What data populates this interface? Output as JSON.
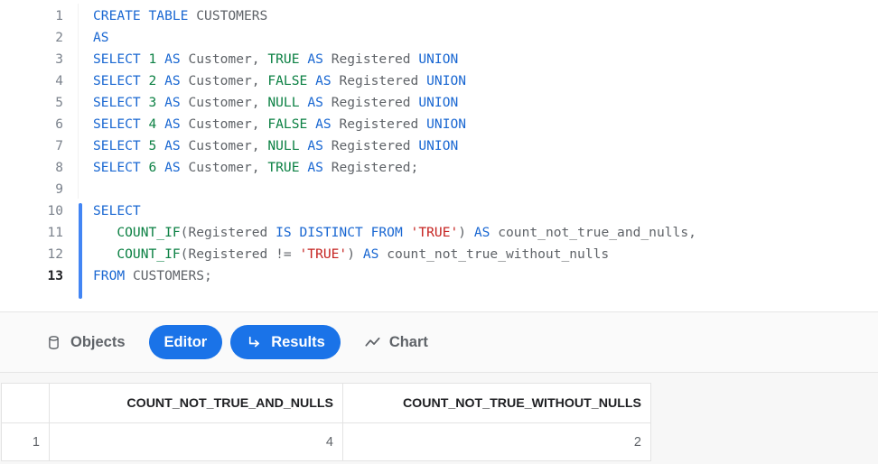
{
  "editor": {
    "line_numbers": [
      "1",
      "2",
      "3",
      "4",
      "5",
      "6",
      "7",
      "8",
      "9",
      "10",
      "11",
      "12",
      "13"
    ],
    "active_line": "13",
    "lines": [
      {
        "n": "1",
        "tokens": [
          {
            "t": "CREATE",
            "c": "kw"
          },
          {
            "t": " ",
            "c": "pn"
          },
          {
            "t": "TABLE",
            "c": "kw"
          },
          {
            "t": " ",
            "c": "pn"
          },
          {
            "t": "CUSTOMERS",
            "c": "id"
          }
        ]
      },
      {
        "n": "2",
        "tokens": [
          {
            "t": "AS",
            "c": "kw"
          }
        ]
      },
      {
        "n": "3",
        "tokens": [
          {
            "t": "SELECT",
            "c": "kw"
          },
          {
            "t": " ",
            "c": "pn"
          },
          {
            "t": "1",
            "c": "lit"
          },
          {
            "t": " ",
            "c": "pn"
          },
          {
            "t": "AS",
            "c": "kw"
          },
          {
            "t": " ",
            "c": "pn"
          },
          {
            "t": "Customer,",
            "c": "id"
          },
          {
            "t": " ",
            "c": "pn"
          },
          {
            "t": "TRUE",
            "c": "lit"
          },
          {
            "t": " ",
            "c": "pn"
          },
          {
            "t": "AS",
            "c": "kw"
          },
          {
            "t": " ",
            "c": "pn"
          },
          {
            "t": "Registered",
            "c": "id"
          },
          {
            "t": " ",
            "c": "pn"
          },
          {
            "t": "UNION",
            "c": "kw"
          }
        ]
      },
      {
        "n": "4",
        "tokens": [
          {
            "t": "SELECT",
            "c": "kw"
          },
          {
            "t": " ",
            "c": "pn"
          },
          {
            "t": "2",
            "c": "lit"
          },
          {
            "t": " ",
            "c": "pn"
          },
          {
            "t": "AS",
            "c": "kw"
          },
          {
            "t": " ",
            "c": "pn"
          },
          {
            "t": "Customer,",
            "c": "id"
          },
          {
            "t": " ",
            "c": "pn"
          },
          {
            "t": "FALSE",
            "c": "lit"
          },
          {
            "t": " ",
            "c": "pn"
          },
          {
            "t": "AS",
            "c": "kw"
          },
          {
            "t": " ",
            "c": "pn"
          },
          {
            "t": "Registered",
            "c": "id"
          },
          {
            "t": " ",
            "c": "pn"
          },
          {
            "t": "UNION",
            "c": "kw"
          }
        ]
      },
      {
        "n": "5",
        "tokens": [
          {
            "t": "SELECT",
            "c": "kw"
          },
          {
            "t": " ",
            "c": "pn"
          },
          {
            "t": "3",
            "c": "lit"
          },
          {
            "t": " ",
            "c": "pn"
          },
          {
            "t": "AS",
            "c": "kw"
          },
          {
            "t": " ",
            "c": "pn"
          },
          {
            "t": "Customer,",
            "c": "id"
          },
          {
            "t": " ",
            "c": "pn"
          },
          {
            "t": "NULL",
            "c": "lit"
          },
          {
            "t": " ",
            "c": "pn"
          },
          {
            "t": "AS",
            "c": "kw"
          },
          {
            "t": " ",
            "c": "pn"
          },
          {
            "t": "Registered",
            "c": "id"
          },
          {
            "t": " ",
            "c": "pn"
          },
          {
            "t": "UNION",
            "c": "kw"
          }
        ]
      },
      {
        "n": "6",
        "tokens": [
          {
            "t": "SELECT",
            "c": "kw"
          },
          {
            "t": " ",
            "c": "pn"
          },
          {
            "t": "4",
            "c": "lit"
          },
          {
            "t": " ",
            "c": "pn"
          },
          {
            "t": "AS",
            "c": "kw"
          },
          {
            "t": " ",
            "c": "pn"
          },
          {
            "t": "Customer,",
            "c": "id"
          },
          {
            "t": " ",
            "c": "pn"
          },
          {
            "t": "FALSE",
            "c": "lit"
          },
          {
            "t": " ",
            "c": "pn"
          },
          {
            "t": "AS",
            "c": "kw"
          },
          {
            "t": " ",
            "c": "pn"
          },
          {
            "t": "Registered",
            "c": "id"
          },
          {
            "t": " ",
            "c": "pn"
          },
          {
            "t": "UNION",
            "c": "kw"
          }
        ]
      },
      {
        "n": "7",
        "tokens": [
          {
            "t": "SELECT",
            "c": "kw"
          },
          {
            "t": " ",
            "c": "pn"
          },
          {
            "t": "5",
            "c": "lit"
          },
          {
            "t": " ",
            "c": "pn"
          },
          {
            "t": "AS",
            "c": "kw"
          },
          {
            "t": " ",
            "c": "pn"
          },
          {
            "t": "Customer,",
            "c": "id"
          },
          {
            "t": " ",
            "c": "pn"
          },
          {
            "t": "NULL",
            "c": "lit"
          },
          {
            "t": " ",
            "c": "pn"
          },
          {
            "t": "AS",
            "c": "kw"
          },
          {
            "t": " ",
            "c": "pn"
          },
          {
            "t": "Registered",
            "c": "id"
          },
          {
            "t": " ",
            "c": "pn"
          },
          {
            "t": "UNION",
            "c": "kw"
          }
        ]
      },
      {
        "n": "8",
        "tokens": [
          {
            "t": "SELECT",
            "c": "kw"
          },
          {
            "t": " ",
            "c": "pn"
          },
          {
            "t": "6",
            "c": "lit"
          },
          {
            "t": " ",
            "c": "pn"
          },
          {
            "t": "AS",
            "c": "kw"
          },
          {
            "t": " ",
            "c": "pn"
          },
          {
            "t": "Customer,",
            "c": "id"
          },
          {
            "t": " ",
            "c": "pn"
          },
          {
            "t": "TRUE",
            "c": "lit"
          },
          {
            "t": " ",
            "c": "pn"
          },
          {
            "t": "AS",
            "c": "kw"
          },
          {
            "t": " ",
            "c": "pn"
          },
          {
            "t": "Registered;",
            "c": "id"
          }
        ]
      },
      {
        "n": "9",
        "tokens": []
      },
      {
        "n": "10",
        "tokens": [
          {
            "t": "SELECT",
            "c": "kw"
          }
        ]
      },
      {
        "n": "11",
        "tokens": [
          {
            "t": "   ",
            "c": "pn"
          },
          {
            "t": "COUNT_IF",
            "c": "fn"
          },
          {
            "t": "(",
            "c": "pn"
          },
          {
            "t": "Registered",
            "c": "id"
          },
          {
            "t": " ",
            "c": "pn"
          },
          {
            "t": "IS",
            "c": "kw"
          },
          {
            "t": " ",
            "c": "pn"
          },
          {
            "t": "DISTINCT",
            "c": "kw"
          },
          {
            "t": " ",
            "c": "pn"
          },
          {
            "t": "FROM",
            "c": "kw"
          },
          {
            "t": " ",
            "c": "pn"
          },
          {
            "t": "'TRUE'",
            "c": "str"
          },
          {
            "t": ")",
            "c": "pn"
          },
          {
            "t": " ",
            "c": "pn"
          },
          {
            "t": "AS",
            "c": "kw"
          },
          {
            "t": " ",
            "c": "pn"
          },
          {
            "t": "count_not_true_and_nulls,",
            "c": "id"
          }
        ]
      },
      {
        "n": "12",
        "tokens": [
          {
            "t": "   ",
            "c": "pn"
          },
          {
            "t": "COUNT_IF",
            "c": "fn"
          },
          {
            "t": "(",
            "c": "pn"
          },
          {
            "t": "Registered",
            "c": "id"
          },
          {
            "t": " ",
            "c": "pn"
          },
          {
            "t": "!=",
            "c": "pn"
          },
          {
            "t": " ",
            "c": "pn"
          },
          {
            "t": "'TRUE'",
            "c": "str"
          },
          {
            "t": ")",
            "c": "pn"
          },
          {
            "t": " ",
            "c": "pn"
          },
          {
            "t": "AS",
            "c": "kw"
          },
          {
            "t": " ",
            "c": "pn"
          },
          {
            "t": "count_not_true_without_nulls",
            "c": "id"
          }
        ]
      },
      {
        "n": "13",
        "tokens": [
          {
            "t": "FROM",
            "c": "kw"
          },
          {
            "t": " ",
            "c": "pn"
          },
          {
            "t": "CUSTOMERS;",
            "c": "id"
          }
        ]
      }
    ]
  },
  "tabs": [
    {
      "label": "Objects",
      "icon": "database-icon",
      "active": false
    },
    {
      "label": "Editor",
      "icon": "",
      "active": true
    },
    {
      "label": "Results",
      "icon": "return-arrow-icon",
      "active": true
    },
    {
      "label": "Chart",
      "icon": "line-chart-icon",
      "active": false
    }
  ],
  "results": {
    "row_index_header": "",
    "columns": [
      "COUNT_NOT_TRUE_AND_NULLS",
      "COUNT_NOT_TRUE_WITHOUT_NULLS"
    ],
    "rows": [
      {
        "index": "1",
        "values": [
          "4",
          "2"
        ]
      }
    ]
  },
  "colors": {
    "accent": "#1a73e8",
    "keyword": "#1967d2",
    "literal": "#0b8043",
    "string": "#c5221f",
    "identifier": "#5f6368"
  }
}
